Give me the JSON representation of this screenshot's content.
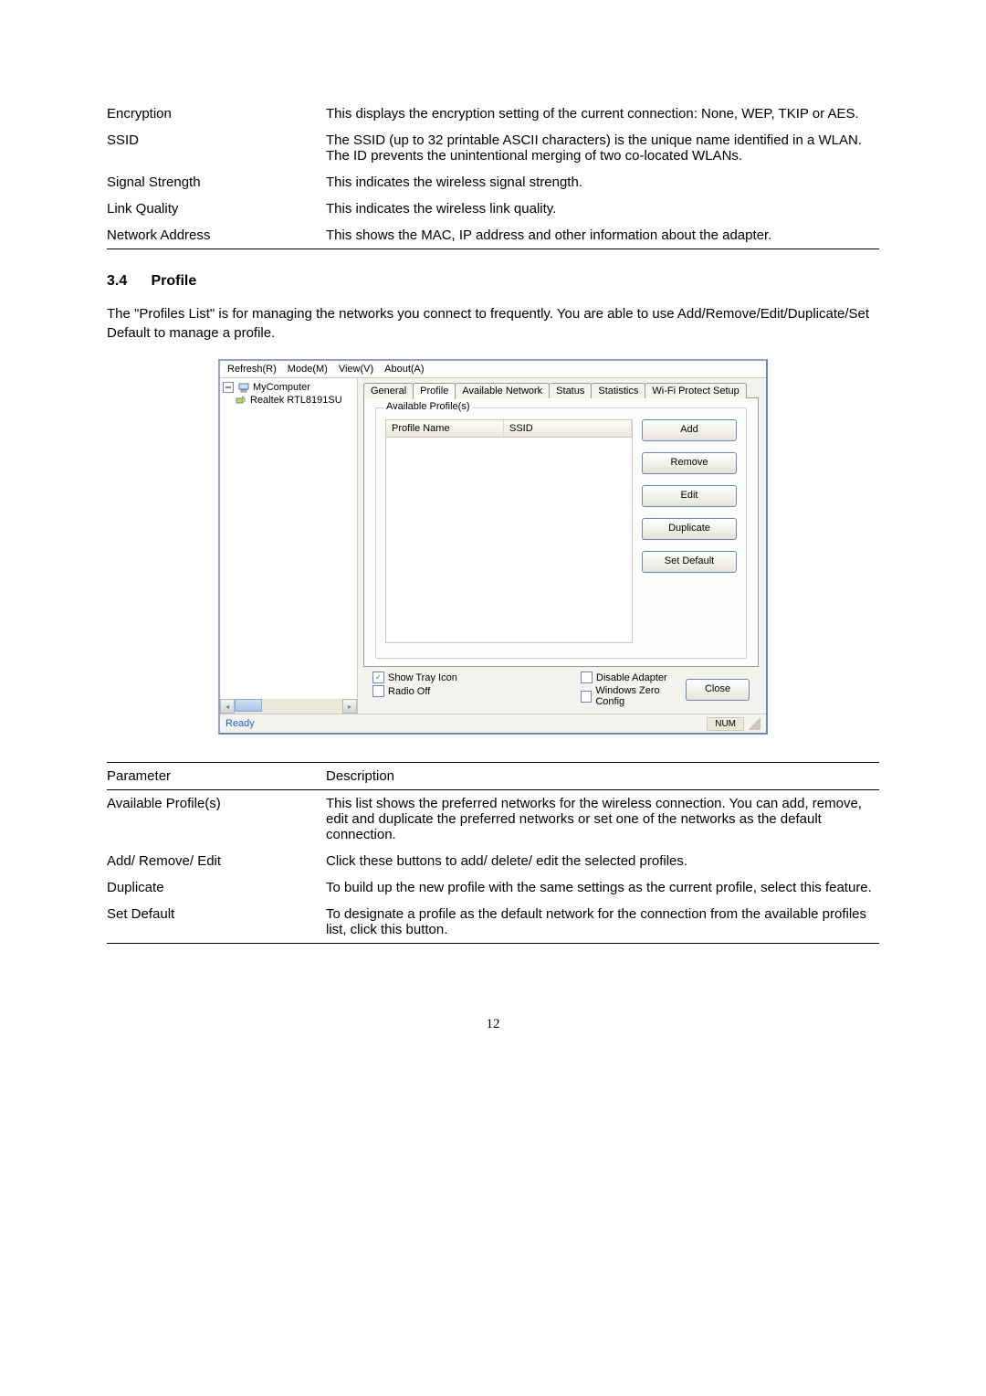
{
  "table1": {
    "rows": [
      {
        "param": "Encryption",
        "desc": "This displays the encryption setting of the current connection: None, WEP, TKIP or AES."
      },
      {
        "param": "SSID",
        "desc": "The SSID (up to 32 printable ASCII characters) is the unique name identified in a WLAN. The ID prevents the unintentional merging of two co-located WLANs."
      },
      {
        "param": "Signal Strength",
        "desc": "This indicates the wireless signal strength."
      },
      {
        "param": "Link Quality",
        "desc": "This indicates the wireless link quality."
      },
      {
        "param": "Network Address",
        "desc": "This shows the MAC, IP address and other information about the adapter."
      }
    ]
  },
  "section": {
    "number": "3.4",
    "title": "Profile",
    "intro": "The \"Profiles List\" is for managing the networks you connect to frequently. You are able to use Add/Remove/Edit/Duplicate/Set Default to manage a profile."
  },
  "screenshot": {
    "menu": {
      "refresh": "Refresh(R)",
      "mode": "Mode(M)",
      "view": "View(V)",
      "about": "About(A)"
    },
    "tree": {
      "root": "MyComputer",
      "child": "Realtek RTL8191SU"
    },
    "tabs": [
      "General",
      "Profile",
      "Available Network",
      "Status",
      "Statistics",
      "Wi-Fi Protect Setup"
    ],
    "active_tab": "Profile",
    "group_label": "Available Profile(s)",
    "list_headers": {
      "name": "Profile Name",
      "ssid": "SSID"
    },
    "buttons": {
      "add": "Add",
      "remove": "Remove",
      "edit": "Edit",
      "duplicate": "Duplicate",
      "set_default": "Set Default",
      "close": "Close"
    },
    "checks": {
      "show_tray": {
        "label": "Show Tray Icon",
        "checked": true
      },
      "radio_off": {
        "label": "Radio Off",
        "checked": false
      },
      "disable_adapter": {
        "label": "Disable Adapter",
        "checked": false
      },
      "win_zero": {
        "label": "Windows Zero Config",
        "checked": false
      }
    },
    "status": {
      "ready": "Ready",
      "num": "NUM"
    }
  },
  "table2": {
    "head_param": "Parameter",
    "head_desc": "Description",
    "rows": [
      {
        "param": "Available Profile(s)",
        "desc": "This list shows the preferred networks for the wireless connection. You can add, remove, edit and duplicate the preferred networks or set one of the networks as the default connection."
      },
      {
        "param": "Add/ Remove/ Edit",
        "desc": "Click these buttons to add/ delete/ edit the selected profiles."
      },
      {
        "param": "Duplicate",
        "desc": "To build up the new profile with the same settings as the current profile, select this feature."
      },
      {
        "param": "Set Default",
        "desc": "To designate a profile as the default network for the connection from the available profiles list, click this button."
      }
    ]
  },
  "page_number": "12"
}
